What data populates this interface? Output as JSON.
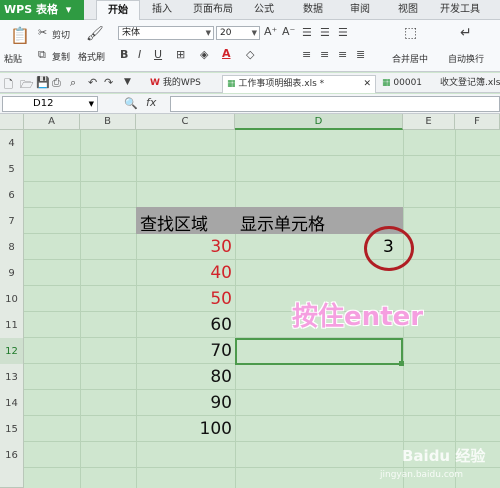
{
  "app": {
    "name": "WPS 表格",
    "menu_arrow": "▾"
  },
  "tabs": [
    "开始",
    "插入",
    "页面布局",
    "公式",
    "数据",
    "审阅",
    "视图",
    "开发工具"
  ],
  "ribbon": {
    "paste": "粘贴",
    "cut": "剪切",
    "copy": "复制",
    "format_painter": "格式刷",
    "font": "宋体",
    "font_size": "20",
    "merge_center": "合并居中",
    "auto_wrap": "自动换行"
  },
  "doc_tabs": [
    "我的WPS",
    "工作事项明细表.xls *",
    "00001",
    "收文登记簿.xls"
  ],
  "name_box": "D12",
  "columns": [
    "A",
    "B",
    "C",
    "D",
    "E",
    "F"
  ],
  "rows": [
    "4",
    "5",
    "6",
    "7",
    "8",
    "9",
    "10",
    "11",
    "12",
    "13",
    "14",
    "15",
    "16"
  ],
  "sheet": {
    "header_c": "查找区域",
    "header_d": "显示单元格",
    "c_values": [
      "30",
      "40",
      "50",
      "60",
      "70",
      "80",
      "90",
      "100"
    ],
    "c_colors": [
      "#d1232a",
      "#d1232a",
      "#d1232a",
      "#111111",
      "#111111",
      "#111111",
      "#111111",
      "#111111"
    ],
    "d8": "3"
  },
  "annotation": "按住enter",
  "watermark": {
    "logo": "Baidu 经验",
    "url": "jingyan.baidu.com"
  }
}
